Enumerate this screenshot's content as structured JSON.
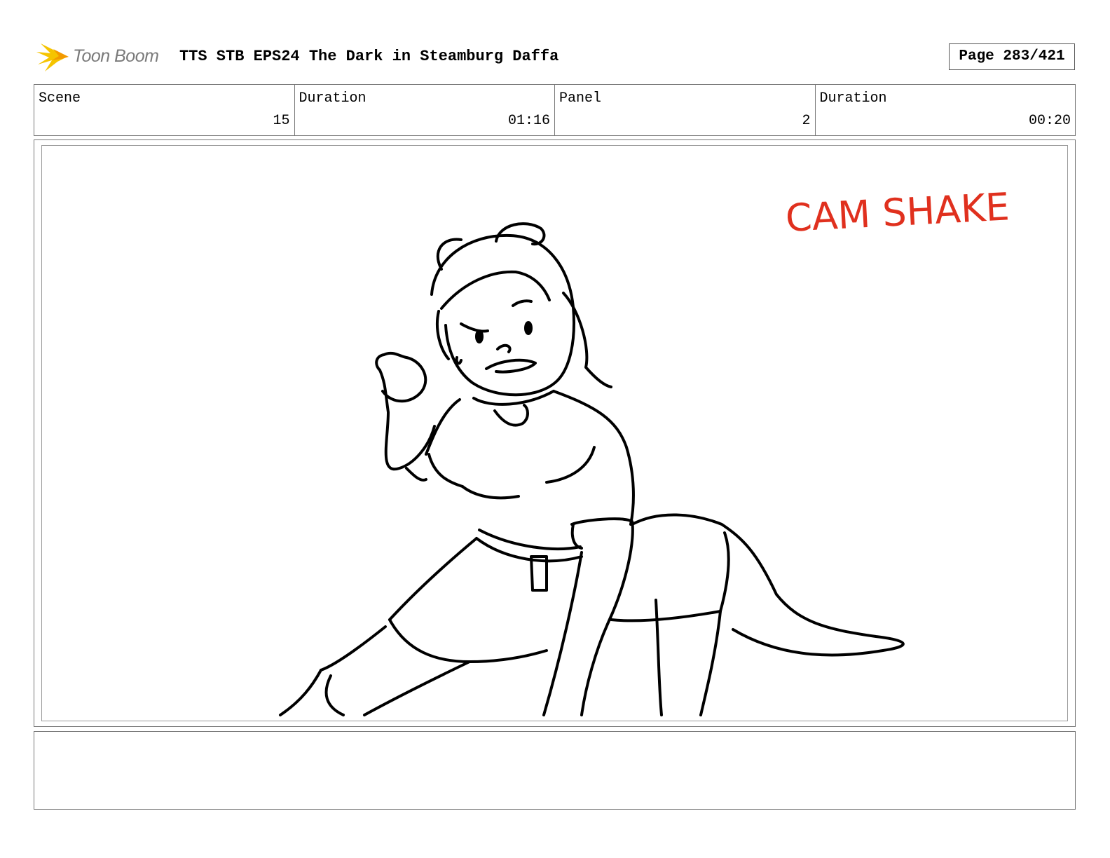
{
  "header": {
    "logo_text": "Toon Boom",
    "doc_title": "TTS STB EPS24 The Dark in Steamburg Daffa",
    "page_label": "Page 283/421"
  },
  "info": {
    "scene_label": "Scene",
    "scene_value": "15",
    "scene_duration_label": "Duration",
    "scene_duration_value": "01:16",
    "panel_label": "Panel",
    "panel_value": "2",
    "panel_duration_label": "Duration",
    "panel_duration_value": "00:20"
  },
  "panel": {
    "annotation": "CAM SHAKE",
    "annotation_color": "#e0301e",
    "logo_accent": "#f5c400"
  },
  "notes": {
    "text": ""
  }
}
